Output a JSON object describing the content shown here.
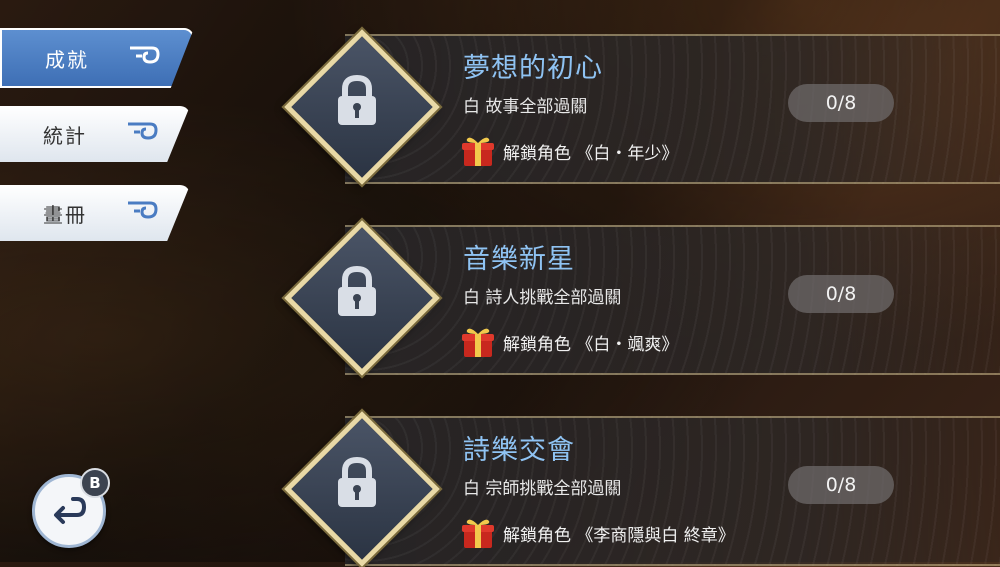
{
  "tabs": [
    {
      "label": "成就",
      "active": true
    },
    {
      "label": "統計",
      "active": false
    },
    {
      "label": "畫冊",
      "active": false
    }
  ],
  "achievements": [
    {
      "title": "夢想的初心",
      "description": "白 故事全部過關",
      "reward": "解鎖角色 《白・年少》",
      "progress": "0/8",
      "icon": "lock-icon"
    },
    {
      "title": "音樂新星",
      "description": "白 詩人挑戰全部過關",
      "reward": "解鎖角色 《白・颯爽》",
      "progress": "0/8",
      "icon": "lock-icon"
    },
    {
      "title": "詩樂交會",
      "description": "白 宗師挑戰全部過關",
      "reward": "解鎖角色 《李商隱與白 終章》",
      "progress": "0/8",
      "icon": "lock-icon"
    }
  ],
  "back_button": {
    "badge": "B",
    "icon": "return-arrow-icon"
  },
  "colors": {
    "title": "#8fc3f3",
    "active_tab": "#4a7cc2",
    "frame_gold": "#e9d9a6"
  }
}
